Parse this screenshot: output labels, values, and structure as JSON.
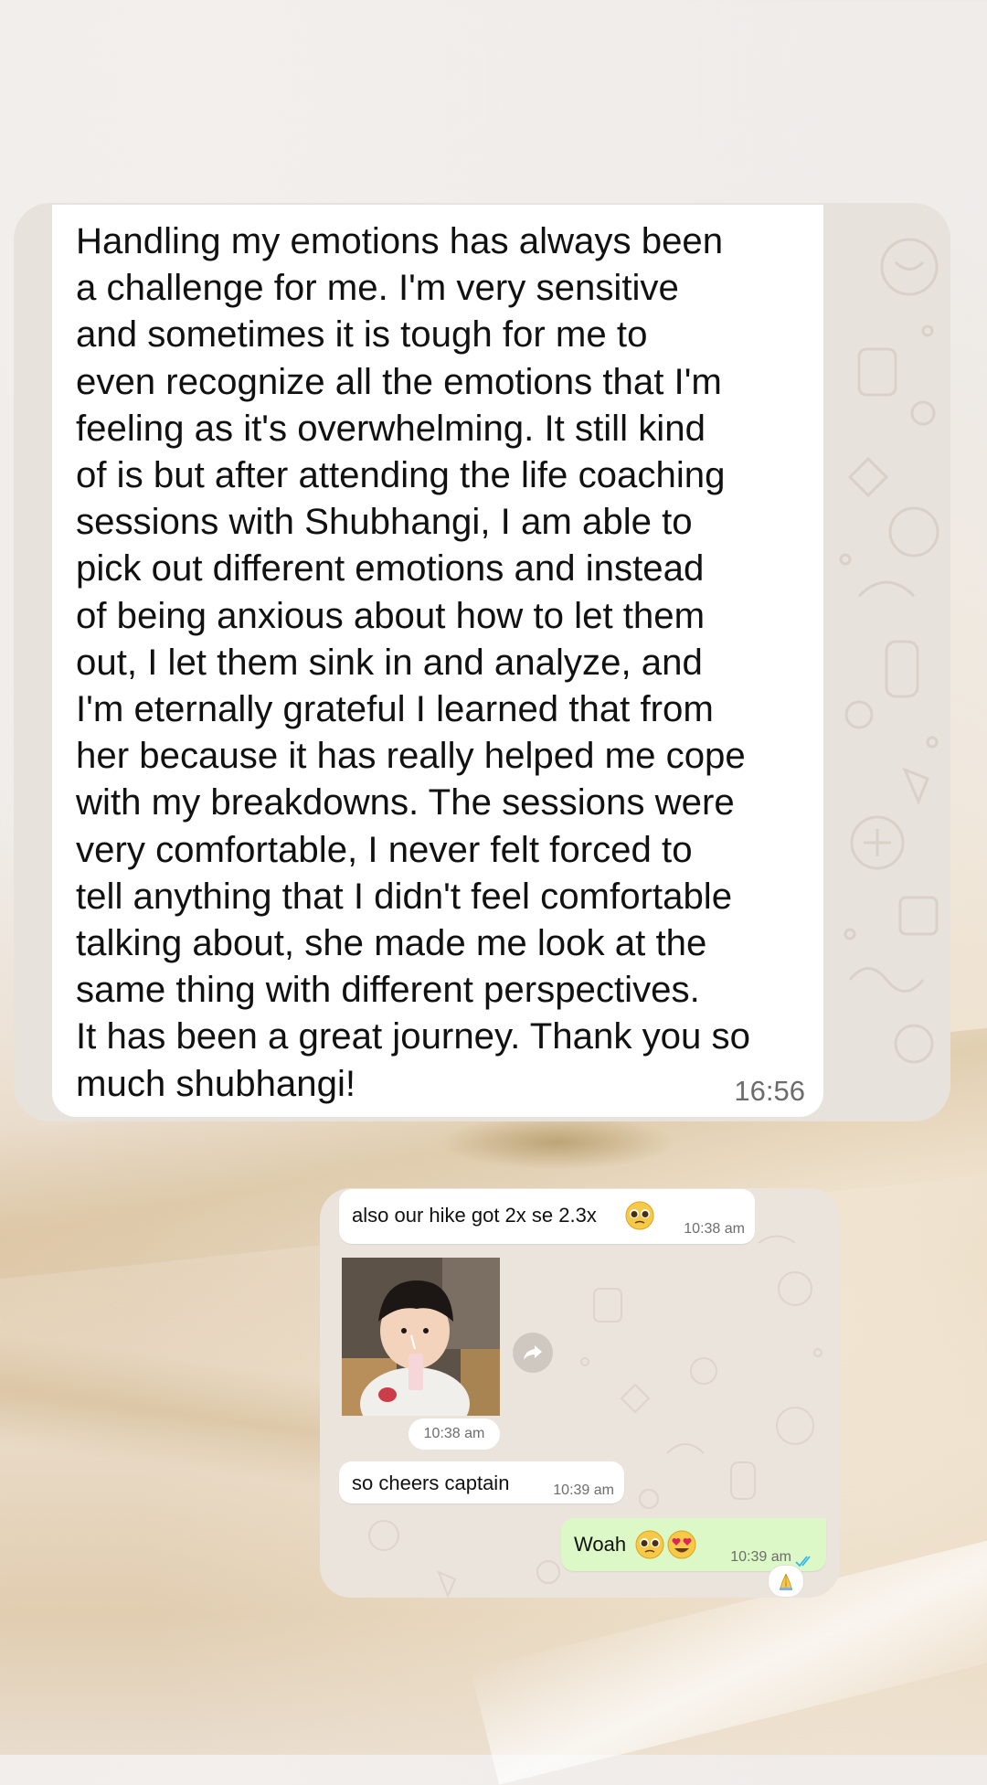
{
  "testimonial": {
    "text": "Handling my emotions has always been\na challenge for me. I'm very sensitive\nand sometimes it is tough for me to\neven recognize all the emotions that I'm\nfeeling as it's overwhelming. It still kind\nof is but after attending the life coaching\nsessions with Shubhangi, I am able to\npick out different emotions and instead\nof being anxious about how to let them\nout, I let them sink in and analyze, and\nI'm eternally grateful I learned that from\nher because it has really helped me cope\nwith my breakdowns. The sessions were\nvery comfortable, I never felt forced to\ntell anything that I didn't feel comfortable\ntalking about, she made me look at the\nsame thing with different perspectives.\nIt has been a great journey. Thank you so\nmuch shubhangi!",
    "time": "16:56"
  },
  "chat": {
    "messages": [
      {
        "text": "also our hike got 2x se 2.3x",
        "emoji": "pleading-face-emoji",
        "time": "10:38 am"
      },
      {
        "type": "photo",
        "icon": "forward-icon",
        "time": "10:38 am"
      },
      {
        "text": "so cheers captain",
        "time": "10:39 am"
      },
      {
        "text": "Woah",
        "emojis": [
          "pleading-face-emoji",
          "heart-eyes-emoji"
        ],
        "time": "10:39 am",
        "status_icon": "double-check-icon",
        "status_color": "#34b7f1",
        "reaction_icon": "folded-hands-emoji"
      }
    ]
  },
  "colors": {
    "incoming_bubble": "#ffffff",
    "outgoing_bubble": "#dcf8c6",
    "read_ticks": "#34b7f1"
  }
}
